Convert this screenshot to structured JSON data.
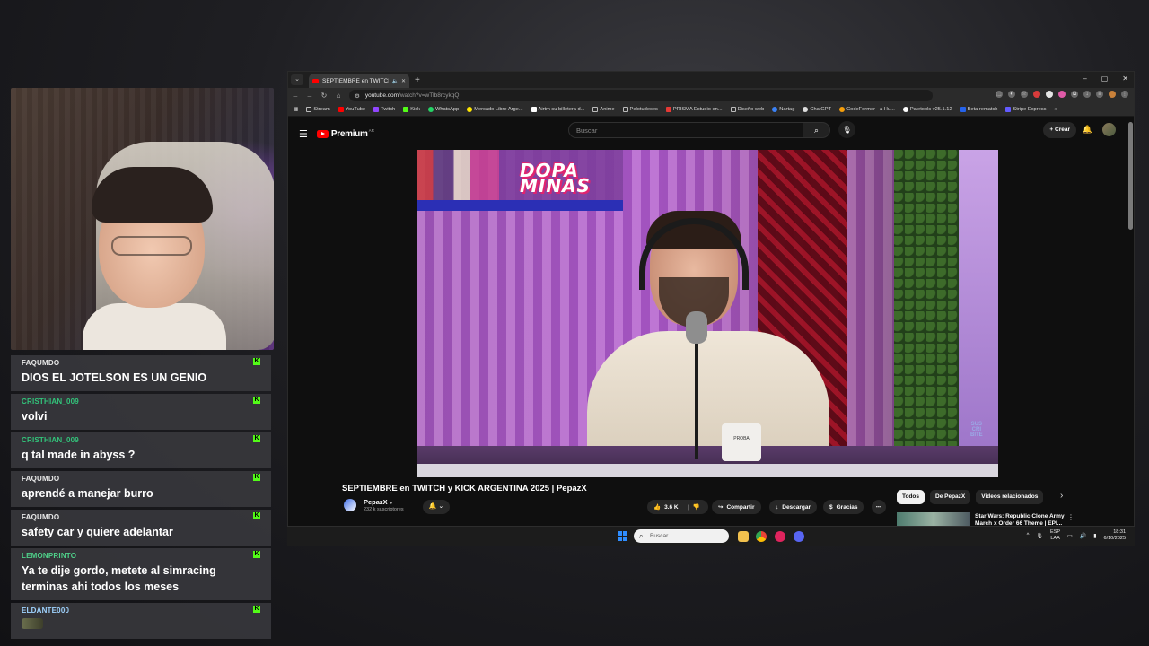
{
  "browser": {
    "tab_title": "SEPTIEMBRE en TWITCH y KICK ARGENTINA 2025 | PepazX",
    "url_host": "youtube.com",
    "url_path": "/watch?v=wTlb8rcykqQ",
    "window_controls": [
      "–",
      "▢",
      "✕"
    ],
    "bookmarks": [
      {
        "label": "Stream",
        "color": "#bbbbbb"
      },
      {
        "label": "YouTube",
        "color": "#ff0000"
      },
      {
        "label": "Twitch",
        "color": "#9146ff"
      },
      {
        "label": "Kick",
        "color": "#53fc18"
      },
      {
        "label": "WhatsApp",
        "color": "#25d366"
      },
      {
        "label": "Mercado Libre Arge...",
        "color": "#ffe600"
      },
      {
        "label": "Airtm su billetera d...",
        "color": "#ffffff"
      },
      {
        "label": "Anime",
        "color": "#bbbbbb"
      },
      {
        "label": "Pelotudeces",
        "color": "#bbbbbb"
      },
      {
        "label": "PRISMA Estudio en...",
        "color": "#e53935"
      },
      {
        "label": "Diseño web",
        "color": "#bbbbbb"
      },
      {
        "label": "Nartag",
        "color": "#3b82f6"
      },
      {
        "label": "ChatGPT",
        "color": "#dddddd"
      },
      {
        "label": "CodeFormer - a Hu...",
        "color": "#f59e0b"
      },
      {
        "label": "Paletools v25.1.12",
        "color": "#ffffff"
      },
      {
        "label": "Beta rematch",
        "color": "#2563eb"
      },
      {
        "label": "Stripe Express",
        "color": "#635bff"
      }
    ]
  },
  "youtube": {
    "logo_text": "Premium",
    "region": "AR",
    "search_placeholder": "Buscar",
    "create_label": "Crear",
    "video_title": "SEPTIEMBRE en TWITCH y KICK ARGENTINA 2025 | PepazX",
    "channel_name": "PepazX",
    "subscribers": "232 k suscriptores",
    "likes": "3.6 K",
    "share_label": "Compartir",
    "download_label": "Descargar",
    "thanks_label": "Gracias",
    "chips": [
      "Todos",
      "De PepazX",
      "Videos relacionados"
    ],
    "rec_title": "Star Wars: Republic Clone Army March x Order 66 Theme | EPI...",
    "video_overlay_logo": "DOPA\nMINAS",
    "watermark": "SUS\nCRI\nBITE",
    "mug_text": "PROBA"
  },
  "taskbar": {
    "search_placeholder": "Buscar",
    "lang_top": "ESP",
    "lang_bottom": "LAA",
    "time": "18:31",
    "date": "6/10/2025"
  },
  "chat": [
    {
      "user": "FAQUMDO",
      "user_color": "#e8e8e8",
      "text": "DIOS EL JOTELSON ES UN GENIO"
    },
    {
      "user": "CRISTHIAN_009",
      "user_color": "#32c37a",
      "text": "volvi"
    },
    {
      "user": "CRISTHIAN_009",
      "user_color": "#32c37a",
      "text": "q tal made in abyss ?"
    },
    {
      "user": "FAQUMDO",
      "user_color": "#e8e8e8",
      "text": "aprendé a manejar burro"
    },
    {
      "user": "FAQUMDO",
      "user_color": "#e8e8e8",
      "text": "safety car y quiere adelantar"
    },
    {
      "user": "LEMONPRINTO",
      "user_color": "#4fd18a",
      "text": "Ya te dije gordo, metete al simracing terminas ahi todos los meses"
    },
    {
      "user": "ELDANTE000",
      "user_color": "#9fd3ff",
      "text": ""
    }
  ]
}
